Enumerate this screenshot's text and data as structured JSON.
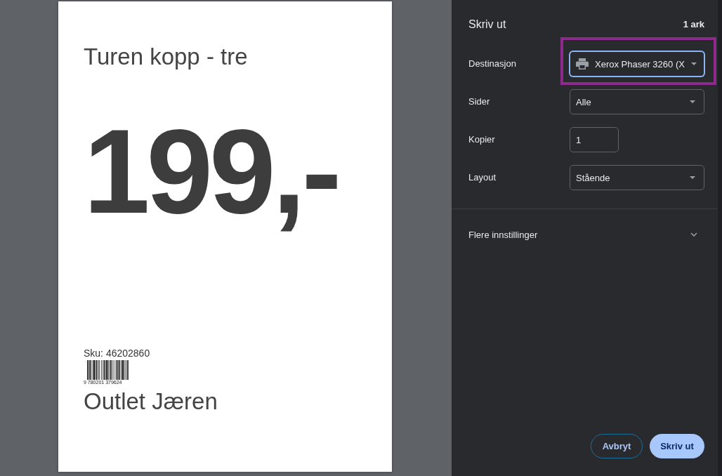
{
  "preview": {
    "page": {
      "title": "Turen kopp - tre",
      "price": "199,-",
      "sku": "Sku: 46202860",
      "barcode_digits": "9 780201 379624",
      "store": "Outlet Jæren"
    }
  },
  "panel": {
    "title": "Skriv ut",
    "sheet_count": "1 ark",
    "settings": [
      {
        "kind": "destination",
        "label": "Destinasjon",
        "value": "Xerox Phaser 3260 (X",
        "focused": true,
        "highlighted": true
      },
      {
        "kind": "select",
        "label": "Sider",
        "value": "Alle",
        "focused": false,
        "highlighted": false
      },
      {
        "kind": "number",
        "label": "Kopier",
        "value": "1",
        "focused": false,
        "highlighted": false
      },
      {
        "kind": "select",
        "label": "Layout",
        "value": "Stående",
        "focused": false,
        "highlighted": false
      }
    ],
    "more_settings": {
      "label": "Flere innstillinger",
      "expanded": false
    },
    "buttons": [
      {
        "kind": "secondary",
        "label": "Avbryt"
      },
      {
        "kind": "primary",
        "label": "Skriv ut"
      }
    ]
  }
}
